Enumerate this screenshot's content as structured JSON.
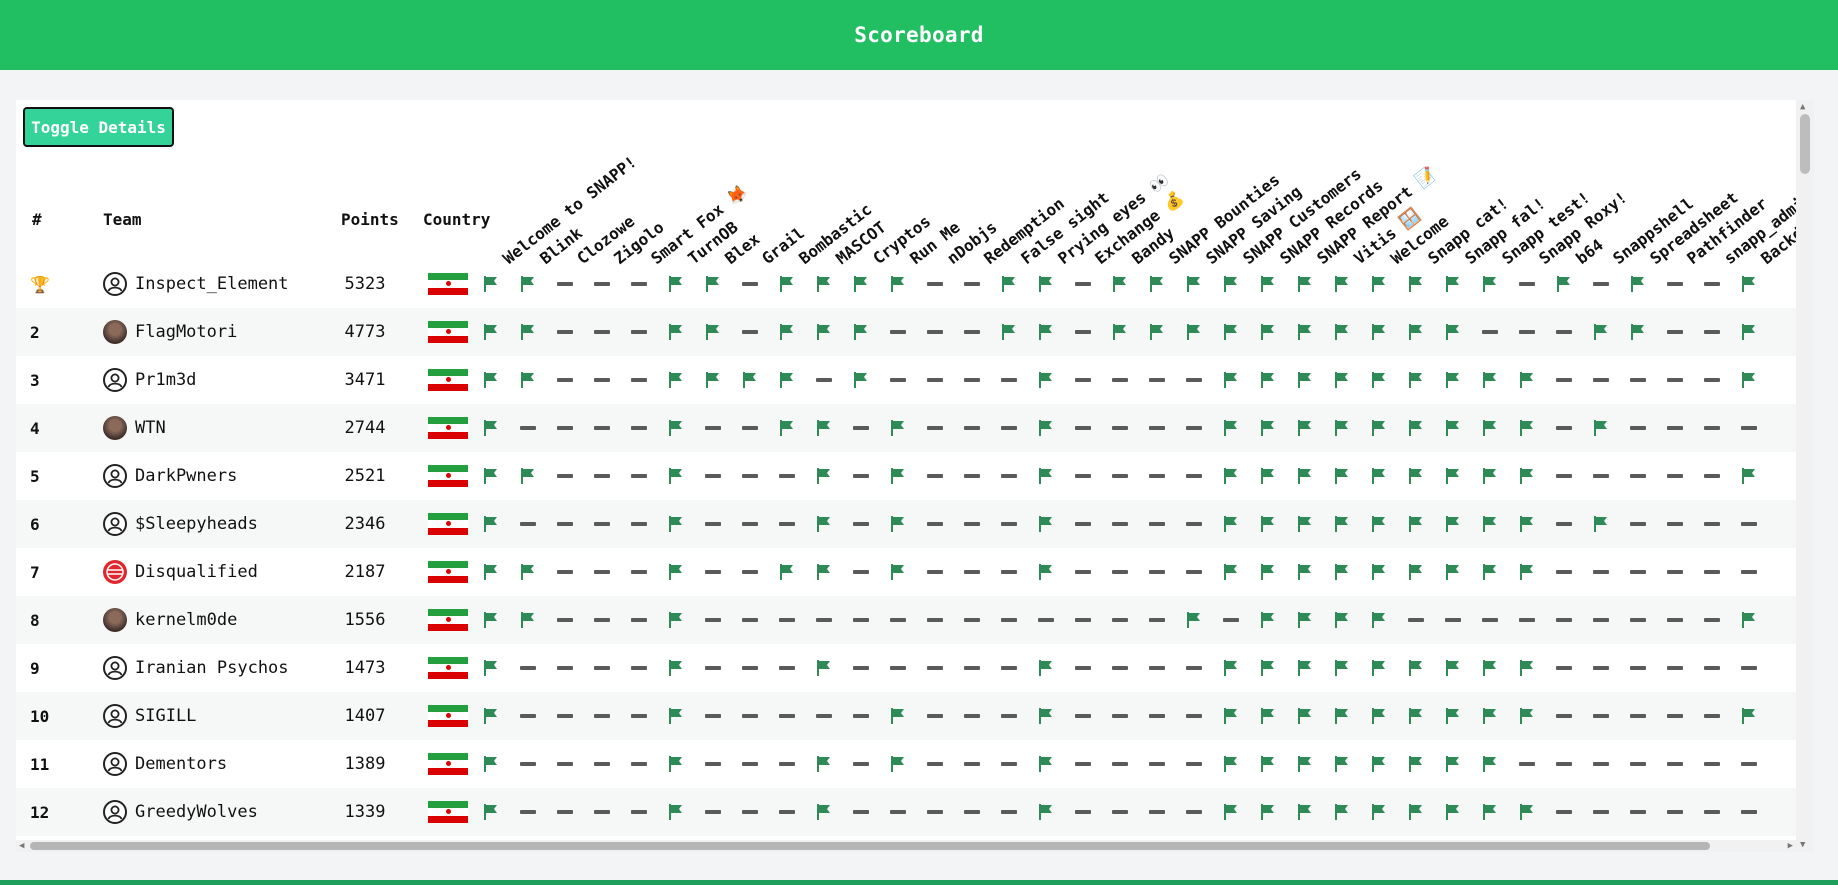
{
  "header": {
    "title": "Scoreboard"
  },
  "toolbar": {
    "toggle_label": "Toggle Details"
  },
  "table": {
    "headers": {
      "rank": "#",
      "team": "Team",
      "points": "Points",
      "country": "Country"
    },
    "challenges": [
      "Welcome to SNAPP!",
      "Blink",
      "Clozowe",
      "Zigolo",
      "Smart Fox 🦊",
      "TurnOB",
      "Blex",
      "Grail",
      "Bombastic",
      "MASCOT",
      "Cryptos",
      "Run Me",
      "nDobjs",
      "Redemption",
      "False sight",
      "Prying eyes 👀",
      "Exchange 💰",
      "Bandy",
      "SNAPP Bounties",
      "SNAPP Saving",
      "SNAPP Customers",
      "SNAPP Records",
      "SNAPP Report 📝",
      "Vitis 🪟",
      "Welcome",
      "Snapp cat!",
      "Snapp fal!",
      "Snapp test!",
      "Snapp Roxy!",
      "b64",
      "Snappshell",
      "Spreadsheet",
      "Pathfinder",
      "snapp_admin",
      "Backd"
    ],
    "rows": [
      {
        "rank": "🏆",
        "team": "Inspect_Element",
        "points": "5323",
        "country": "Iran",
        "avatar": "default",
        "solves": "1100011011110011011111111111010100110"
      },
      {
        "rank": "2",
        "team": "FlagMotori",
        "points": "4773",
        "country": "Iran",
        "avatar": "photo",
        "solves": "1100011011100011011111111110001100110"
      },
      {
        "rank": "3",
        "team": "Pr1m3d",
        "points": "3471",
        "country": "Iran",
        "avatar": "default",
        "solves": "1100011110100001000011111111100000100"
      },
      {
        "rank": "4",
        "team": "WTN",
        "points": "2744",
        "country": "Iran",
        "avatar": "photo",
        "solves": "1000010011010001000011111111101000000"
      },
      {
        "rank": "5",
        "team": "DarkPwners",
        "points": "2521",
        "country": "Iran",
        "avatar": "default",
        "solves": "1100010001010001000011111111100000100"
      },
      {
        "rank": "6",
        "team": "$Sleepyheads",
        "points": "2346",
        "country": "Iran",
        "avatar": "default",
        "solves": "1000010001010001000011111111101000000"
      },
      {
        "rank": "7",
        "team": "Disqualified",
        "points": "2187",
        "country": "Iran",
        "avatar": "badge",
        "solves": "1100010011010001000011111111100000000"
      },
      {
        "rank": "8",
        "team": "kernelm0de",
        "points": "1556",
        "country": "Iran",
        "avatar": "photo",
        "solves": "1100010000000000000101111000000000100"
      },
      {
        "rank": "9",
        "team": "Iranian Psychos",
        "points": "1473",
        "country": "Iran",
        "avatar": "default",
        "solves": "1000010001000001000011111111100000000"
      },
      {
        "rank": "10",
        "team": "SIGILL",
        "points": "1407",
        "country": "Iran",
        "avatar": "default",
        "solves": "1000010000010001000011111111100000100"
      },
      {
        "rank": "11",
        "team": "Dementors",
        "points": "1389",
        "country": "Iran",
        "avatar": "default",
        "solves": "1000010001010001000011111111000000000"
      },
      {
        "rank": "12",
        "team": "GreedyWolves",
        "points": "1339",
        "country": "Iran",
        "avatar": "default",
        "solves": "1000010001000001000011111111100000000"
      }
    ]
  },
  "icons": {
    "solved": "flag-icon",
    "unsolved": "dash-icon"
  },
  "colors": {
    "header_bg": "#22bf62",
    "button_bg": "#34d39a",
    "solved_flag": "#2e8b57",
    "unsolved_dash": "#5a5a5a"
  }
}
